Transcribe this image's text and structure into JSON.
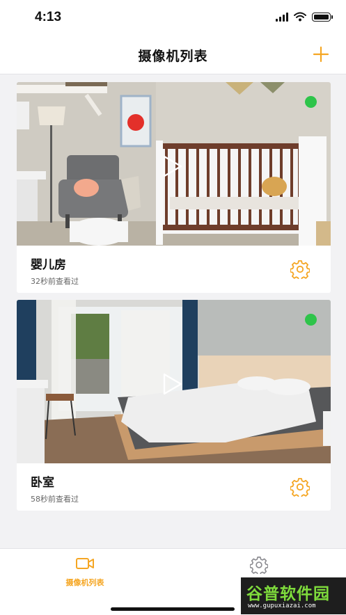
{
  "status_bar": {
    "time": "4:13"
  },
  "header": {
    "title": "摄像机列表",
    "add_icon": "plus-icon"
  },
  "cameras": [
    {
      "name": "婴儿房",
      "last_viewed": "32秒前查看过",
      "status": "online",
      "status_color": "#2ec44a"
    },
    {
      "name": "卧室",
      "last_viewed": "58秒前查看过",
      "status": "online",
      "status_color": "#2ec44a"
    }
  ],
  "tab_bar": {
    "tabs": [
      {
        "label": "摄像机列表",
        "icon": "video-camera-icon",
        "active": true
      },
      {
        "label": "",
        "icon": "gear-icon",
        "active": false
      }
    ]
  },
  "watermark": {
    "text": "谷普软件园",
    "url": "www.gupuxiazai.com"
  },
  "colors": {
    "accent": "#f5a623",
    "online": "#2ec44a"
  }
}
